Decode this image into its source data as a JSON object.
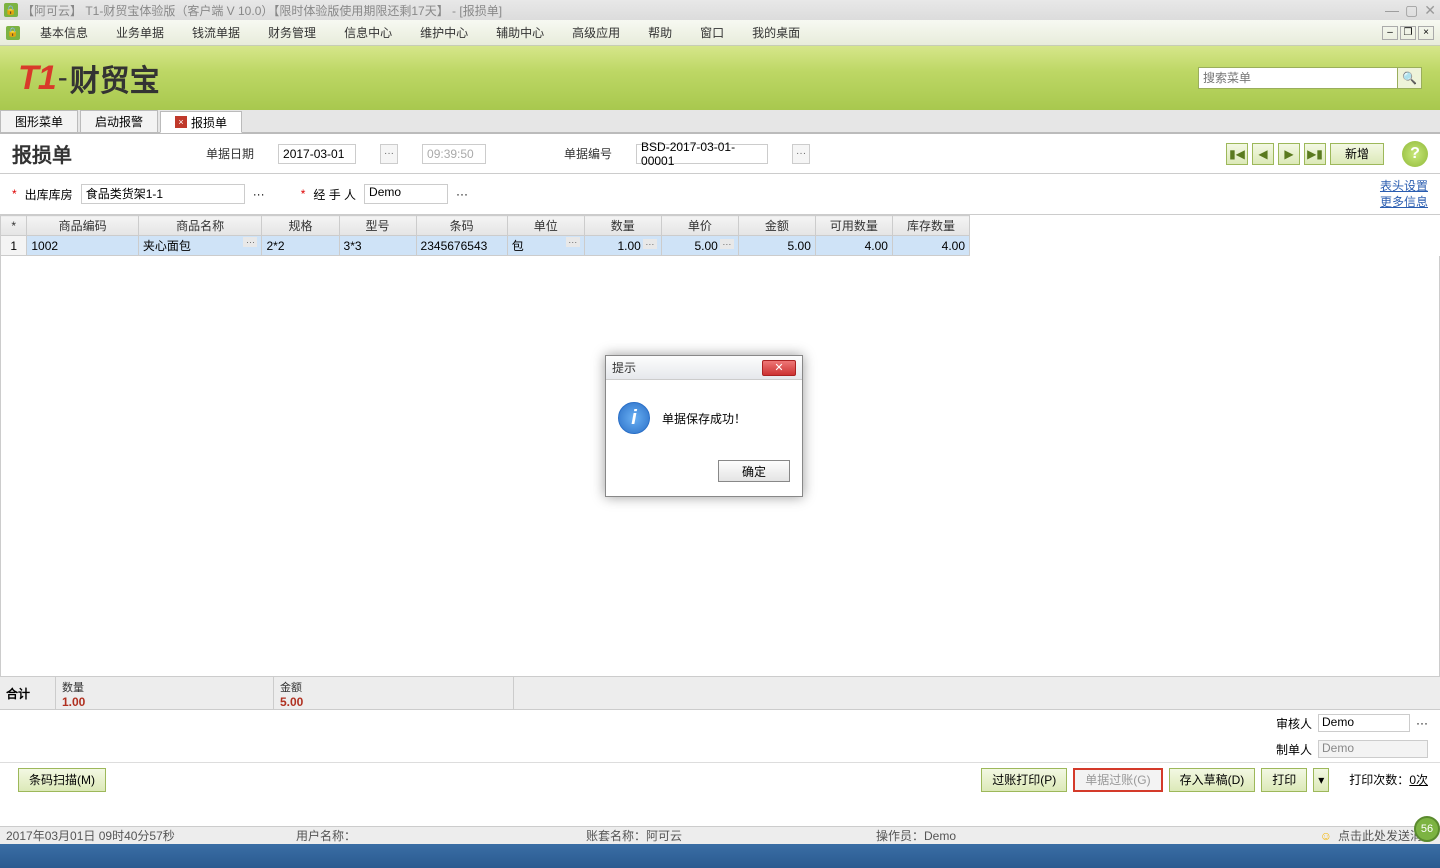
{
  "titlebar": {
    "text": "【阿可云】 T1-财贸宝体验版（客户端 V 10.0）【限时体验版使用期限还剩17天】 - [报损单]"
  },
  "menus": [
    "基本信息",
    "业务单据",
    "钱流单据",
    "财务管理",
    "信息中心",
    "维护中心",
    "辅助中心",
    "高级应用",
    "帮助",
    "窗口",
    "我的桌面"
  ],
  "search": {
    "placeholder": "搜索菜单"
  },
  "tabs": [
    {
      "label": "图形菜单",
      "closable": false
    },
    {
      "label": "启动报警",
      "closable": false
    },
    {
      "label": "报损单",
      "closable": true,
      "active": true
    }
  ],
  "form": {
    "title": "报损单",
    "date_label": "单据日期",
    "date_value": "2017-03-01",
    "time_value": "09:39:50",
    "docno_label": "单据编号",
    "docno_value": "BSD-2017-03-01-00001",
    "new_btn": "新增",
    "warehouse_label": "出库库房",
    "warehouse_value": "食品类货架1-1",
    "handler_label": "经 手 人",
    "handler_value": "Demo",
    "link1": "表头设置",
    "link2": "更多信息"
  },
  "grid": {
    "headers": [
      "*",
      "商品编码",
      "商品名称",
      "规格",
      "型号",
      "条码",
      "单位",
      "数量",
      "单价",
      "金额",
      "可用数量",
      "库存数量"
    ],
    "row": {
      "idx": "1",
      "code": "1002",
      "name": "夹心面包",
      "spec": "2*2",
      "model": "3*3",
      "barcode": "2345676543",
      "unit": "包",
      "qty": "1.00",
      "price": "5.00",
      "amount": "5.00",
      "avail": "4.00",
      "stock": "4.00"
    }
  },
  "totals": {
    "label": "合计",
    "qty_label": "数量",
    "qty_value": "1.00",
    "amt_label": "金额",
    "amt_value": "5.00"
  },
  "approver": {
    "审核人_label": "审核人",
    "审核人_value": "Demo",
    "制单人_label": "制单人",
    "制单人_value": "Demo"
  },
  "actions": {
    "scan": "条码扫描(M)",
    "post_print": "过账打印(P)",
    "post": "单据过账(G)",
    "save_draft": "存入草稿(D)",
    "print": "打印",
    "print_count_label": "打印次数：",
    "print_count_value": "0次"
  },
  "status": {
    "datetime": "2017年03月01日    09时40分57秒",
    "user_label": "用户名称：",
    "book_label": "账套名称：阿可云",
    "operator_label": "操作员：Demo",
    "msg": "点击此处发送消息",
    "badge": "56"
  },
  "modal": {
    "title": "提示",
    "message": "单据保存成功！",
    "ok": "确定"
  }
}
